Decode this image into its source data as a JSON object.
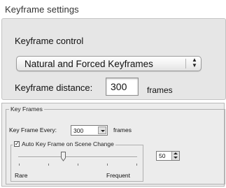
{
  "mac": {
    "title": "Keyframe settings",
    "control_label": "Keyframe control",
    "mode_value": "Natural and Forced Keyframes",
    "distance_label": "Keyframe distance:",
    "distance_value": "300",
    "distance_unit": "frames"
  },
  "win": {
    "group_title": "Key Frames",
    "every_label": "Key Frame Every:",
    "every_value": "300",
    "every_unit": "frames",
    "auto_label": "Auto Key Frame on Scene Change",
    "auto_checked": true,
    "sensitivity_value": "50",
    "sensitivity_level": 0.5,
    "slider_min_label": "Rare",
    "slider_max_label": "Frequent"
  }
}
